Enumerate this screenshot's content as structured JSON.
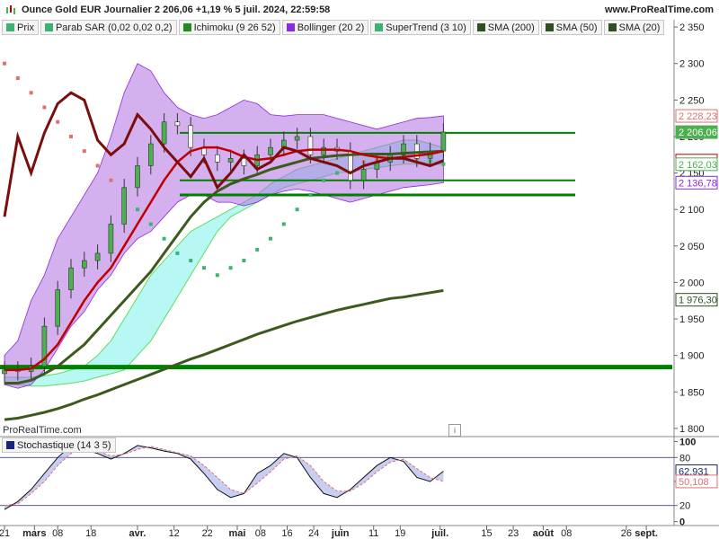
{
  "header": {
    "title": "Ounce Gold EUR Journalier 2 206,06 +1,19 % 5 juil. 2024, 22:59:58",
    "site": "www.ProRealTime.com"
  },
  "legend": [
    {
      "label": "Prix",
      "color": "#3cb371"
    },
    {
      "label": "Parab SAR (0,02 0,02 0,2)",
      "color": "#3cb371"
    },
    {
      "label": "Ichimoku (9 26 52)",
      "color": "#228b22"
    },
    {
      "label": "Bollinger (20 2)",
      "color": "#8a2be2"
    },
    {
      "label": "SuperTrend (3 10)",
      "color": "#3cb371"
    },
    {
      "label": "SMA (200)",
      "color": "#2f4f1f"
    },
    {
      "label": "SMA (50)",
      "color": "#2f4f1f"
    },
    {
      "label": "SMA (20)",
      "color": "#2f4f1f"
    }
  ],
  "brand": "ProRealTime.com",
  "info_icon": "info-icon",
  "stochastic_label": "Stochastique (14 3 5)",
  "chart_data": [
    {
      "type": "candlestick",
      "series_name": "Ounce Gold EUR",
      "y_ticks": [
        "2 350",
        "2 300",
        "2 250",
        "2 200",
        "2 150",
        "2 100",
        "2 050",
        "2 000",
        "1 950",
        "1 900",
        "1 850",
        "1 800"
      ],
      "ylim": [
        1790,
        2360
      ],
      "x_ticks": [
        {
          "label": "21",
          "bold": false,
          "day": 0
        },
        {
          "label": "mars",
          "bold": true,
          "day": 9
        },
        {
          "label": "08",
          "bold": false,
          "day": 16
        },
        {
          "label": "18",
          "bold": false,
          "day": 26
        },
        {
          "label": "avr.",
          "bold": true,
          "day": 40
        },
        {
          "label": "12",
          "bold": false,
          "day": 51
        },
        {
          "label": "22",
          "bold": false,
          "day": 61
        },
        {
          "label": "mai",
          "bold": true,
          "day": 70
        },
        {
          "label": "08",
          "bold": false,
          "day": 77
        },
        {
          "label": "16",
          "bold": false,
          "day": 85
        },
        {
          "label": "24",
          "bold": false,
          "day": 93
        },
        {
          "label": "juin",
          "bold": true,
          "day": 101
        },
        {
          "label": "11",
          "bold": false,
          "day": 111
        },
        {
          "label": "19",
          "bold": false,
          "day": 119
        },
        {
          "label": "juil.",
          "bold": true,
          "day": 131
        },
        {
          "label": "15",
          "bold": false,
          "day": 145
        },
        {
          "label": "23",
          "bold": false,
          "day": 153
        },
        {
          "label": "août",
          "bold": true,
          "day": 162
        },
        {
          "label": "08",
          "bold": false,
          "day": 169
        },
        {
          "label": "26",
          "bold": false,
          "day": 187
        },
        {
          "label": "sept.",
          "bold": true,
          "day": 193
        }
      ],
      "price_tags": [
        {
          "label": "2 228,23",
          "value": 2228.23,
          "color": "#e07070",
          "filled": false
        },
        {
          "label": "2 206,06",
          "value": 2206.06,
          "color": "#4caf50",
          "filled": true
        },
        {
          "label": "2 166,98",
          "value": 2166.98,
          "color": "#c00000",
          "filled": false
        },
        {
          "label": "2 162,03",
          "value": 2162.03,
          "color": "#4caf50",
          "filled": false
        },
        {
          "label": "2 136,78",
          "value": 2136.78,
          "color": "#8a2be2",
          "filled": false
        },
        {
          "label": "1 976,30",
          "value": 1976.3,
          "color": "#2f4f1f",
          "filled": false
        }
      ],
      "x": [
        0,
        4,
        8,
        12,
        16,
        20,
        24,
        28,
        32,
        36,
        40,
        44,
        48,
        52,
        56,
        60,
        64,
        68,
        72,
        76,
        80,
        84,
        88,
        92,
        96,
        100,
        104,
        108,
        112,
        116,
        120,
        124,
        128,
        132
      ],
      "close": [
        1880,
        1878,
        1885,
        1940,
        1990,
        2020,
        2030,
        2040,
        2080,
        2130,
        2160,
        2190,
        2220,
        2215,
        2185,
        2175,
        2165,
        2170,
        2160,
        2175,
        2185,
        2195,
        2200,
        2175,
        2185,
        2180,
        2140,
        2155,
        2165,
        2175,
        2190,
        2170,
        2180,
        2206.06
      ],
      "sma20": [
        1880,
        1880,
        1882,
        1895,
        1915,
        1945,
        1975,
        2000,
        2020,
        2050,
        2080,
        2110,
        2140,
        2165,
        2180,
        2185,
        2185,
        2180,
        2172,
        2168,
        2170,
        2175,
        2180,
        2182,
        2182,
        2182,
        2180,
        2175,
        2172,
        2170,
        2172,
        2174,
        2176,
        2180
      ],
      "sma50": [
        1862,
        1862,
        1866,
        1875,
        1885,
        1900,
        1915,
        1935,
        1955,
        1975,
        1995,
        2015,
        2040,
        2065,
        2090,
        2110,
        2125,
        2135,
        2142,
        2148,
        2155,
        2160,
        2165,
        2170,
        2172,
        2174,
        2175,
        2176,
        2176,
        2176,
        2177,
        2178,
        2179,
        2180
      ],
      "sma200": [
        1812,
        1814,
        1818,
        1822,
        1827,
        1833,
        1840,
        1846,
        1853,
        1860,
        1867,
        1874,
        1881,
        1888,
        1895,
        1901,
        1908,
        1915,
        1922,
        1929,
        1935,
        1941,
        1947,
        1952,
        1957,
        1962,
        1966,
        1970,
        1974,
        1978,
        1980,
        1983,
        1986,
        1989
      ],
      "tenkan": [
        2090,
        2200,
        2150,
        2205,
        2245,
        2260,
        2250,
        2195,
        2175,
        2190,
        2230,
        2210,
        2185,
        2165,
        2145,
        2170,
        2130,
        2150,
        2175,
        2155,
        2165,
        2185,
        2180,
        2170,
        2165,
        2160,
        2150,
        2160,
        2165,
        2170,
        2170,
        2165,
        2160,
        2166.98
      ],
      "bb_upper": [
        1900,
        1920,
        1975,
        2010,
        2060,
        2090,
        2120,
        2150,
        2200,
        2260,
        2300,
        2290,
        2260,
        2240,
        2230,
        2225,
        2230,
        2240,
        2250,
        2245,
        2230,
        2228,
        2230,
        2230,
        2230,
        2225,
        2220,
        2215,
        2210,
        2215,
        2220,
        2225,
        2226,
        2228.23
      ],
      "bb_lower": [
        1860,
        1855,
        1860,
        1880,
        1910,
        1940,
        1960,
        1990,
        2010,
        2040,
        2060,
        2070,
        2090,
        2110,
        2120,
        2120,
        2110,
        2110,
        2105,
        2110,
        2120,
        2125,
        2128,
        2125,
        2120,
        2115,
        2110,
        2115,
        2120,
        2125,
        2130,
        2132,
        2134,
        2136.78
      ],
      "cloud_upper": [
        1870,
        1870,
        1870,
        1872,
        1875,
        1880,
        1885,
        1900,
        1920,
        1950,
        1980,
        2010,
        2030,
        2050,
        2070,
        2080,
        2090,
        2100,
        2110,
        2120,
        2135,
        2145,
        2155,
        2160,
        2165,
        2170,
        2175,
        2180,
        2185,
        2190,
        2195,
        2195,
        2190,
        2185
      ],
      "cloud_lower": [
        1860,
        1860,
        1858,
        1858,
        1860,
        1862,
        1865,
        1870,
        1875,
        1880,
        1900,
        1920,
        1950,
        1980,
        2010,
        2040,
        2070,
        2090,
        2100,
        2110,
        2120,
        2130,
        2135,
        2140,
        2145,
        2150,
        2152,
        2155,
        2157,
        2160,
        2162,
        2162,
        2162,
        2162
      ],
      "sar": [
        2300,
        2280,
        2260,
        2240,
        2220,
        2200,
        2180,
        2160,
        2140,
        2120,
        2100,
        2080,
        2060,
        2040,
        2030,
        2020,
        2010,
        2020,
        2030,
        2045,
        2060,
        2080,
        2100,
        2120,
        2140,
        2150,
        2160,
        2165,
        2168,
        2170,
        2172,
        2170,
        2166,
        2162.03
      ],
      "support_lines": [
        {
          "value": 1884,
          "color": "#008000",
          "width": 5
        },
        {
          "value": 2120,
          "color": "#008000",
          "width": 3
        },
        {
          "value": 2140,
          "color": "#008000",
          "width": 2
        },
        {
          "value": 2205,
          "color": "#008000",
          "width": 2
        }
      ]
    },
    {
      "type": "line",
      "series_name": "Stochastique (14 3 5)",
      "y_ticks": [
        "100",
        "80",
        "50",
        "20",
        "0"
      ],
      "ylim": [
        -5,
        105
      ],
      "levels": [
        80,
        20
      ],
      "price_tags": [
        {
          "label": "62,931",
          "value": 62.931,
          "color": "#1a237e"
        },
        {
          "label": "50,108",
          "value": 50.108,
          "color": "#e07070"
        }
      ],
      "x": [
        0,
        4,
        8,
        12,
        16,
        20,
        24,
        28,
        32,
        36,
        40,
        44,
        48,
        52,
        56,
        60,
        64,
        68,
        72,
        76,
        80,
        84,
        88,
        92,
        96,
        100,
        104,
        108,
        112,
        116,
        120,
        124,
        128,
        132
      ],
      "k": [
        15,
        25,
        40,
        60,
        80,
        95,
        90,
        85,
        78,
        85,
        95,
        92,
        88,
        85,
        78,
        60,
        40,
        30,
        35,
        60,
        70,
        85,
        80,
        55,
        35,
        30,
        40,
        55,
        70,
        80,
        75,
        55,
        50,
        62.931
      ],
      "d": [
        20,
        22,
        35,
        50,
        70,
        85,
        92,
        88,
        82,
        84,
        90,
        94,
        90,
        86,
        82,
        70,
        55,
        40,
        35,
        48,
        62,
        78,
        82,
        70,
        50,
        38,
        38,
        48,
        62,
        74,
        78,
        66,
        55,
        50.108
      ]
    }
  ]
}
